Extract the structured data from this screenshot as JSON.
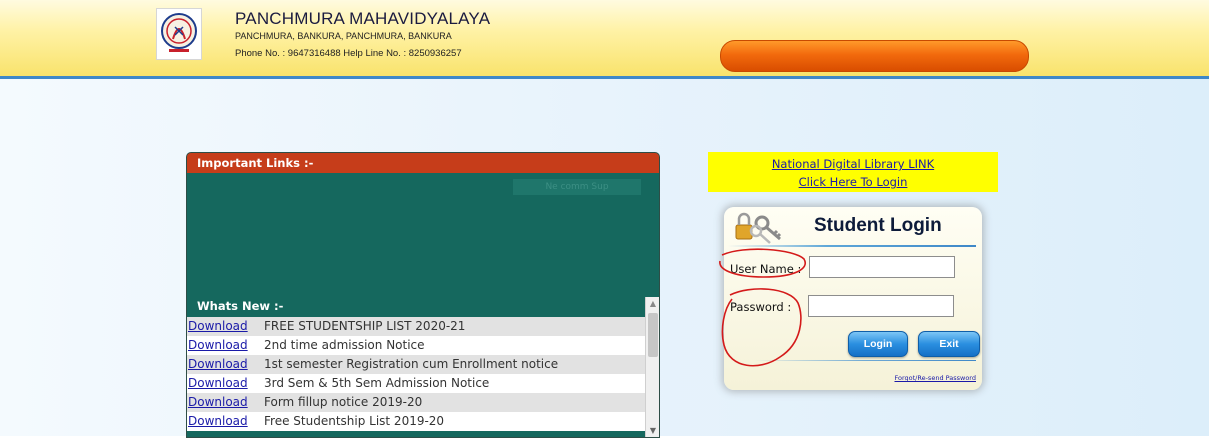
{
  "header": {
    "college_name": "PANCHMURA MAHAVIDYALAYA",
    "address": "PANCHMURA, BANKURA, PANCHMURA, BANKURA",
    "contact": "Phone No. : 9647316488   Help Line No. : 8250936257"
  },
  "links_panel": {
    "heading": "Important Links :-",
    "ghost_text": "Ne comm Sup",
    "whats_new_heading": "Whats New :-",
    "news": [
      {
        "link": "Download",
        "text": "FREE STUDENTSHIP LIST 2020-21"
      },
      {
        "link": "Download",
        "text": "2nd time admission Notice"
      },
      {
        "link": "Download",
        "text": "1st semester Registration cum Enrollment notice"
      },
      {
        "link": "Download",
        "text": "3rd Sem & 5th Sem Admission Notice"
      },
      {
        "link": "Download",
        "text": "Form fillup notice 2019-20"
      },
      {
        "link": "Download",
        "text": "Free Studentship List 2019-20"
      }
    ]
  },
  "library": {
    "line1": "National Digital Library LINK",
    "line2": "Click Here To Login"
  },
  "login": {
    "title": "Student Login",
    "username_label": "User Name :",
    "password_label": "Password :",
    "username_value": "",
    "password_value": "",
    "login_button": "Login",
    "exit_button": "Exit",
    "forgot_link": "Forgot/Re-send Password"
  },
  "colors": {
    "header_bg": "#f9e36c",
    "links_head": "#c63d1a",
    "links_panel": "#15685e",
    "library_bg": "#ffff00",
    "button_blue": "#2a8fe0",
    "annotation_red": "#d41a1a"
  },
  "icons": {
    "logo": "college-emblem-logo",
    "keys": "keys-lock-icon"
  }
}
